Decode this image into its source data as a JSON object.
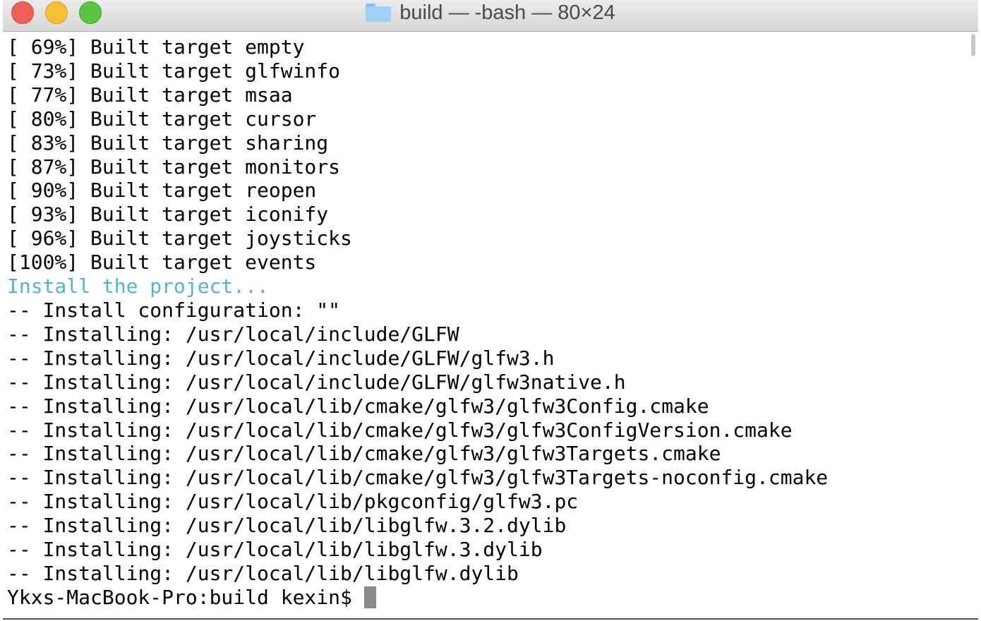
{
  "window": {
    "title": "build — -bash — 80×24",
    "title_icon": "folder-icon",
    "accent_output_color": "#4fb8c8"
  },
  "lines": [
    {
      "text": "[ 69%] Built target empty"
    },
    {
      "text": "[ 73%] Built target glfwinfo"
    },
    {
      "text": "[ 77%] Built target msaa"
    },
    {
      "text": "[ 80%] Built target cursor"
    },
    {
      "text": "[ 83%] Built target sharing"
    },
    {
      "text": "[ 87%] Built target monitors"
    },
    {
      "text": "[ 90%] Built target reopen"
    },
    {
      "text": "[ 93%] Built target iconify"
    },
    {
      "text": "[ 96%] Built target joysticks"
    },
    {
      "text": "[100%] Built target events"
    },
    {
      "text": "Install the project...",
      "color": "#4fb8c8"
    },
    {
      "text": "-- Install configuration: \"\""
    },
    {
      "text": "-- Installing: /usr/local/include/GLFW"
    },
    {
      "text": "-- Installing: /usr/local/include/GLFW/glfw3.h"
    },
    {
      "text": "-- Installing: /usr/local/include/GLFW/glfw3native.h"
    },
    {
      "text": "-- Installing: /usr/local/lib/cmake/glfw3/glfw3Config.cmake"
    },
    {
      "text": "-- Installing: /usr/local/lib/cmake/glfw3/glfw3ConfigVersion.cmake"
    },
    {
      "text": "-- Installing: /usr/local/lib/cmake/glfw3/glfw3Targets.cmake"
    },
    {
      "text": "-- Installing: /usr/local/lib/cmake/glfw3/glfw3Targets-noconfig.cmake"
    },
    {
      "text": "-- Installing: /usr/local/lib/pkgconfig/glfw3.pc"
    },
    {
      "text": "-- Installing: /usr/local/lib/libglfw.3.2.dylib"
    },
    {
      "text": "-- Installing: /usr/local/lib/libglfw.3.dylib"
    },
    {
      "text": "-- Installing: /usr/local/lib/libglfw.dylib"
    }
  ],
  "prompt": "Ykxs-MacBook-Pro:build kexin$"
}
